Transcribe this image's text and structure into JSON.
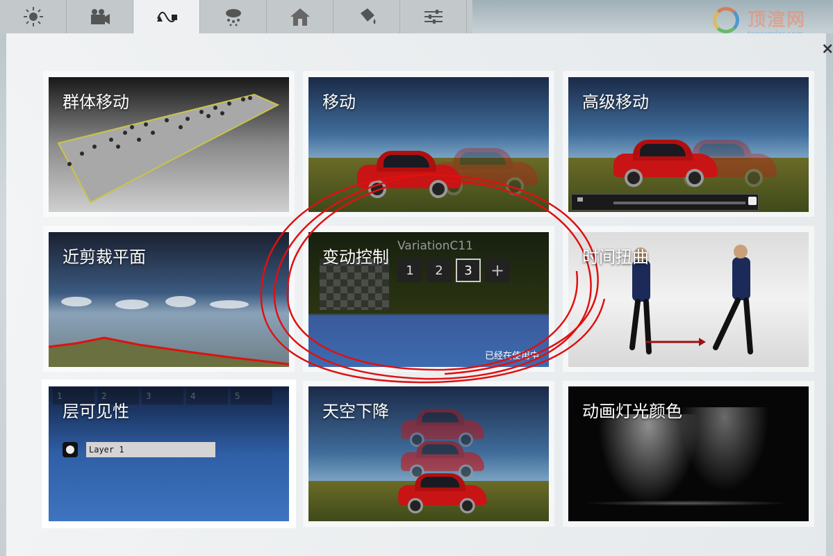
{
  "tabs": [
    {
      "name": "sun-icon",
      "active": false
    },
    {
      "name": "camera-icon",
      "active": false
    },
    {
      "name": "path-icon",
      "active": true
    },
    {
      "name": "weather-icon",
      "active": false
    },
    {
      "name": "house-icon",
      "active": false
    },
    {
      "name": "paint-bucket-icon",
      "active": false
    },
    {
      "name": "sliders-icon",
      "active": false
    }
  ],
  "watermark": {
    "text": "顶渲网",
    "sub": "toprender.com"
  },
  "close_glyph": "×",
  "cards": [
    {
      "title": "群体移动"
    },
    {
      "title": "移动"
    },
    {
      "title": "高级移动"
    },
    {
      "title": "近剪裁平面"
    },
    {
      "title": "变动控制",
      "variation_label": "VariationC11",
      "slots": [
        "1",
        "2",
        "3",
        "+"
      ],
      "in_use": "已经在使用中"
    },
    {
      "title": "时间扭曲"
    },
    {
      "title": "层可见性",
      "layer_label": "Layer 1",
      "layer_slots": [
        "1",
        "2",
        "3",
        "4",
        "5"
      ]
    },
    {
      "title": "天空下降"
    },
    {
      "title": "动画灯光颜色"
    }
  ],
  "colors": {
    "accent_red": "#e01010",
    "selected_border": "#ffffff"
  }
}
